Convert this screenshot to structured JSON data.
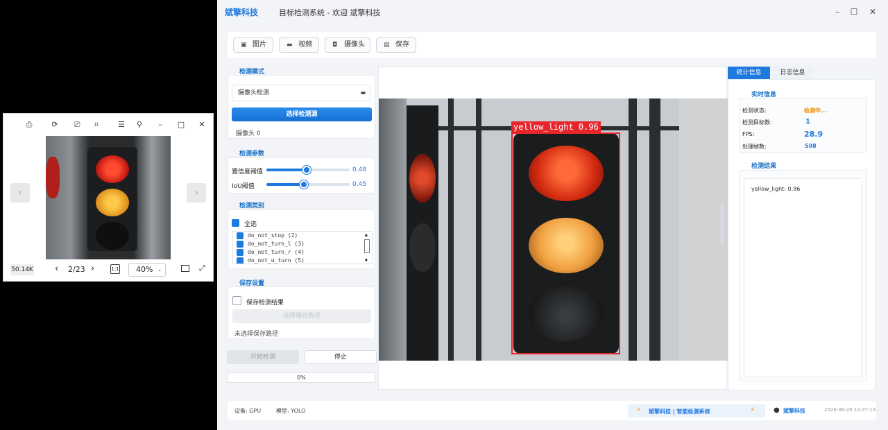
{
  "viewer": {
    "toolbar_icons": [
      "export-icon",
      "rotate-icon",
      "print-icon",
      "crop-icon",
      "menu-icon",
      "pin-icon"
    ],
    "minimize": "–",
    "maximize": "□",
    "close": "✕",
    "file_size": "50.14K",
    "page_index": "2/23",
    "zoom": "40%"
  },
  "app": {
    "brand": "斌擎科技",
    "title_rest": "目标检测系统 - 欢迎 斌擎科技",
    "window_controls": {
      "minimize": "–",
      "maximize": "☐",
      "close": "✕"
    },
    "toolbar": [
      {
        "label": "图片",
        "icon": "image-icon"
      },
      {
        "label": "视频",
        "icon": "video-icon"
      },
      {
        "label": "摄像头",
        "icon": "camera-icon"
      },
      {
        "label": "保存",
        "icon": "save-icon"
      }
    ],
    "mode": {
      "title": "检测模式",
      "selected": "摄像头检测",
      "select_source_button": "选择检测源",
      "source_info": "摄像头 0"
    },
    "params": {
      "title": "检测参数",
      "confidence_label": "置信度阈值",
      "confidence_value": "0.48",
      "confidence_fraction": 0.48,
      "iou_label": "IoU阈值",
      "iou_value": "0.45",
      "iou_fraction": 0.45
    },
    "classes": {
      "title": "检测类别",
      "select_all_label": "全选",
      "select_all_checked": true,
      "items": [
        "do_not_stop (2)",
        "do_not_turn_l (3)",
        "do_not_turn_r (4)",
        "do_not_u_turn (5)"
      ]
    },
    "save": {
      "title": "保存设置",
      "save_checkbox_label": "保存检测结果",
      "save_checked": false,
      "path_button": "选择保存路径",
      "path_status": "未选择保存路径"
    },
    "actions": {
      "start": "开始检测",
      "stop": "停止"
    },
    "progress": {
      "text": "0%",
      "value": 0
    },
    "detection": {
      "label": "yellow_light  0.96"
    },
    "right_tabs": {
      "active": "统计信息",
      "inactive": "日志信息"
    },
    "realtime": {
      "title": "实时信息",
      "rows": [
        {
          "label": "检测状态:",
          "value": "检测中...",
          "color": "#f08c00"
        },
        {
          "label": "检测目标数:",
          "value": "1",
          "color": "#1f7ae0"
        },
        {
          "label": "FPS:",
          "value": "28.9",
          "color": "#1f7ae0"
        },
        {
          "label": "处理帧数:",
          "value": "508",
          "color": "#1f7ae0"
        }
      ]
    },
    "results": {
      "title": "检测结果",
      "text": "yellow_light: 0.96"
    },
    "statusbar": {
      "device": "设备: GPU",
      "model": "模型: YOLO",
      "center_text": "斌擎科技 | 智能检测系统",
      "user": "斌擎科技",
      "datetime": "2026-06-26 14:37:13"
    },
    "colors": {
      "accent": "#1f7ae0",
      "detection_box": "#e7262c",
      "status_running": "#f08c00"
    }
  }
}
